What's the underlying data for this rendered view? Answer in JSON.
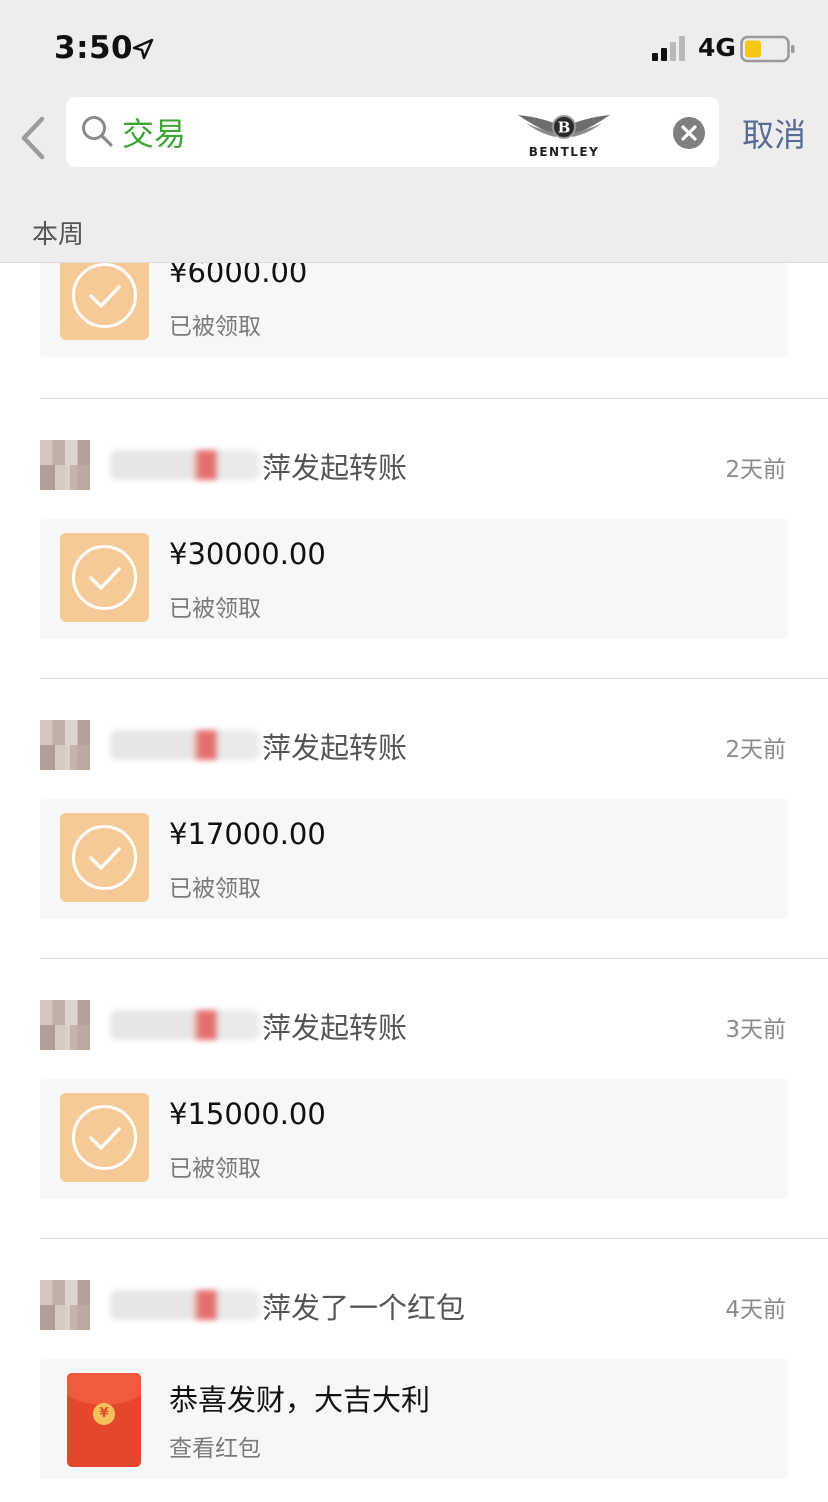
{
  "status_bar": {
    "time": "3:50",
    "network": "4G"
  },
  "search": {
    "query": "交易",
    "logo_text": "BENTLEY",
    "cancel_label": "取消"
  },
  "section": {
    "label": "本周"
  },
  "items": [
    {
      "amount": "¥6000.00",
      "status": "已被领取"
    },
    {
      "action": "萍发起转账",
      "time": "2天前",
      "amount": "¥30000.00",
      "status": "已被领取"
    },
    {
      "action": "萍发起转账",
      "time": "2天前",
      "amount": "¥17000.00",
      "status": "已被领取"
    },
    {
      "action": "萍发起转账",
      "time": "3天前",
      "amount": "¥15000.00",
      "status": "已被领取"
    },
    {
      "action": "萍发了一个红包",
      "time": "4天前",
      "title": "恭喜发财，大吉大利",
      "sub": "查看红包"
    }
  ],
  "colors": {
    "accent_green": "#3fa535",
    "link_blue": "#576b95",
    "transfer_tile": "#f5ca96",
    "red_packet": "#e4472b"
  }
}
